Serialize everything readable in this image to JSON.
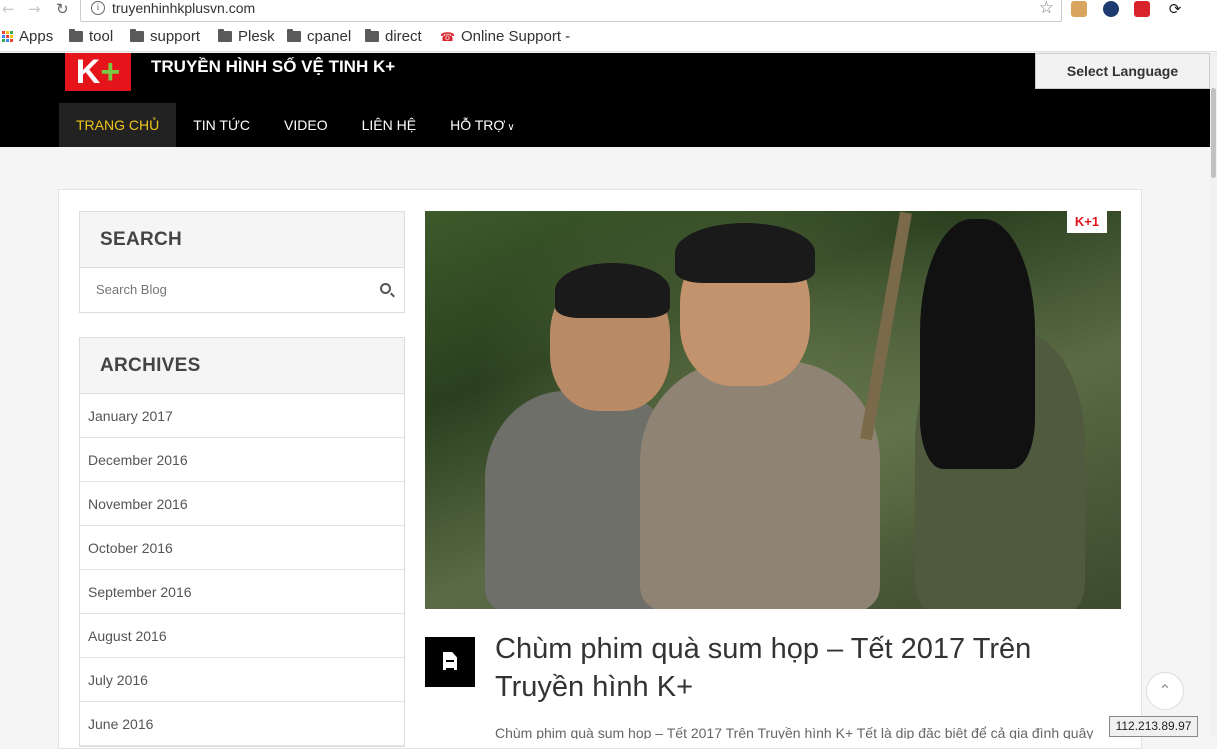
{
  "browser": {
    "url": "truyenhinhkplusvn.com",
    "bookmarks": [
      "Apps",
      "tool",
      "support",
      "Plesk",
      "cpanel",
      "direct",
      "Online Support -"
    ]
  },
  "header": {
    "logo_text": "K+",
    "site_title": "TRUYỀN HÌNH SỐ VỆ TINH K+",
    "language_button": "Select Language",
    "menu": [
      "TRANG CHỦ",
      "TIN TỨC",
      "VIDEO",
      "LIÊN HỆ",
      "HỖ TRỢ"
    ],
    "active_menu": "TRANG CHỦ"
  },
  "sidebar": {
    "search_title": "SEARCH",
    "search_placeholder": "Search Blog",
    "archives_title": "ARCHIVES",
    "archives": [
      "January 2017",
      "December 2016",
      "November 2016",
      "October 2016",
      "September 2016",
      "August 2016",
      "July 2016",
      "June 2016"
    ]
  },
  "post": {
    "image_badge": "K+1",
    "title": "Chùm phim quà sum họp – Tết 2017 Trên Truyền hình K+",
    "excerpt": "Chùm phim quà sum họp – Tết 2017 Trên Truyền hình K+ Tết là dịp đặc biệt để cả gia đình quây"
  },
  "overlay": {
    "ip": "112.213.89.97",
    "back_to_top": "⌃"
  },
  "colors": {
    "header_bg": "#000000",
    "logo_red": "#e5141b",
    "logo_green": "#7ac943",
    "menu_active": "#f0c419"
  }
}
